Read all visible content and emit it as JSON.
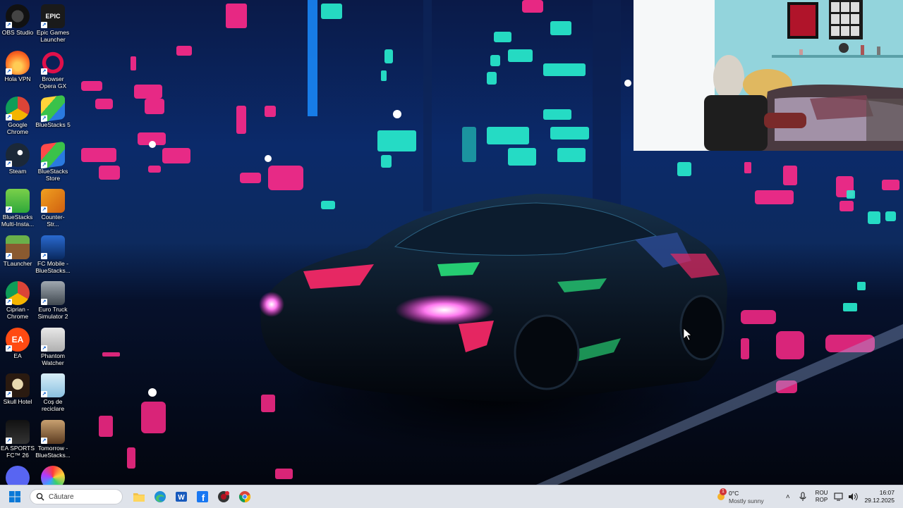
{
  "desktop": {
    "icons": [
      {
        "label": "OBS Studio",
        "icon": "obs-icon"
      },
      {
        "label": "Epic Games\nLauncher",
        "icon": "epic-games-icon",
        "glyph": "EPIC"
      },
      {
        "label": "Hola VPN",
        "icon": "hola-vpn-icon"
      },
      {
        "label": "Browser\nOpera GX",
        "icon": "opera-gx-icon"
      },
      {
        "label": "Google\nChrome",
        "icon": "chrome-icon"
      },
      {
        "label": "BlueStacks 5",
        "icon": "bluestacks-icon"
      },
      {
        "label": "Steam",
        "icon": "steam-icon"
      },
      {
        "label": "BlueStacks\nStore",
        "icon": "bluestacks-store-icon"
      },
      {
        "label": "BlueStacks\nMulti-Insta...",
        "icon": "bluestacks-multi-instance-icon"
      },
      {
        "label": "Counter-Str...\n2",
        "icon": "counter-strike-icon"
      },
      {
        "label": "TLauncher",
        "icon": "tlauncher-icon"
      },
      {
        "label": "FC Mobile -\nBlueStacks...",
        "icon": "fc-mobile-icon"
      },
      {
        "label": "Ciprian -\nChrome",
        "icon": "chrome-profile-icon"
      },
      {
        "label": "Euro Truck\nSimulator 2",
        "icon": "euro-truck-icon"
      },
      {
        "label": "EA",
        "icon": "ea-icon",
        "glyph": "EA"
      },
      {
        "label": "Phantom\nWatcher",
        "icon": "phantom-watcher-icon"
      },
      {
        "label": "Skull Hotel",
        "icon": "skull-hotel-icon"
      },
      {
        "label": "Coș de\nreciclare",
        "icon": "recycle-bin-icon"
      },
      {
        "label": "EA SPORTS\nFC™ 26",
        "icon": "ea-sports-fc-icon"
      },
      {
        "label": "Tomorrow -\nBlueStacks...",
        "icon": "tomorrow-icon"
      },
      {
        "label": "",
        "icon": "discord-icon"
      },
      {
        "label": "",
        "icon": "color-wheel-icon"
      }
    ]
  },
  "taskbar": {
    "search_placeholder": "Căutare",
    "pinned": [
      "file-explorer-icon",
      "edge-icon",
      "word-icon",
      "facebook-icon",
      "app-icon",
      "chrome-taskbar-icon"
    ],
    "weather": {
      "temp": "0°C",
      "desc": "Mostly sunny",
      "badge": "1"
    },
    "lang_line1": "ROU",
    "lang_line2": "ROP",
    "time": "16:07",
    "date": "29.12.2025"
  },
  "colors": {
    "neon_pink": "#ff2a8a",
    "neon_cyan": "#29f0d0",
    "taskbar": "#dfe3ea"
  }
}
